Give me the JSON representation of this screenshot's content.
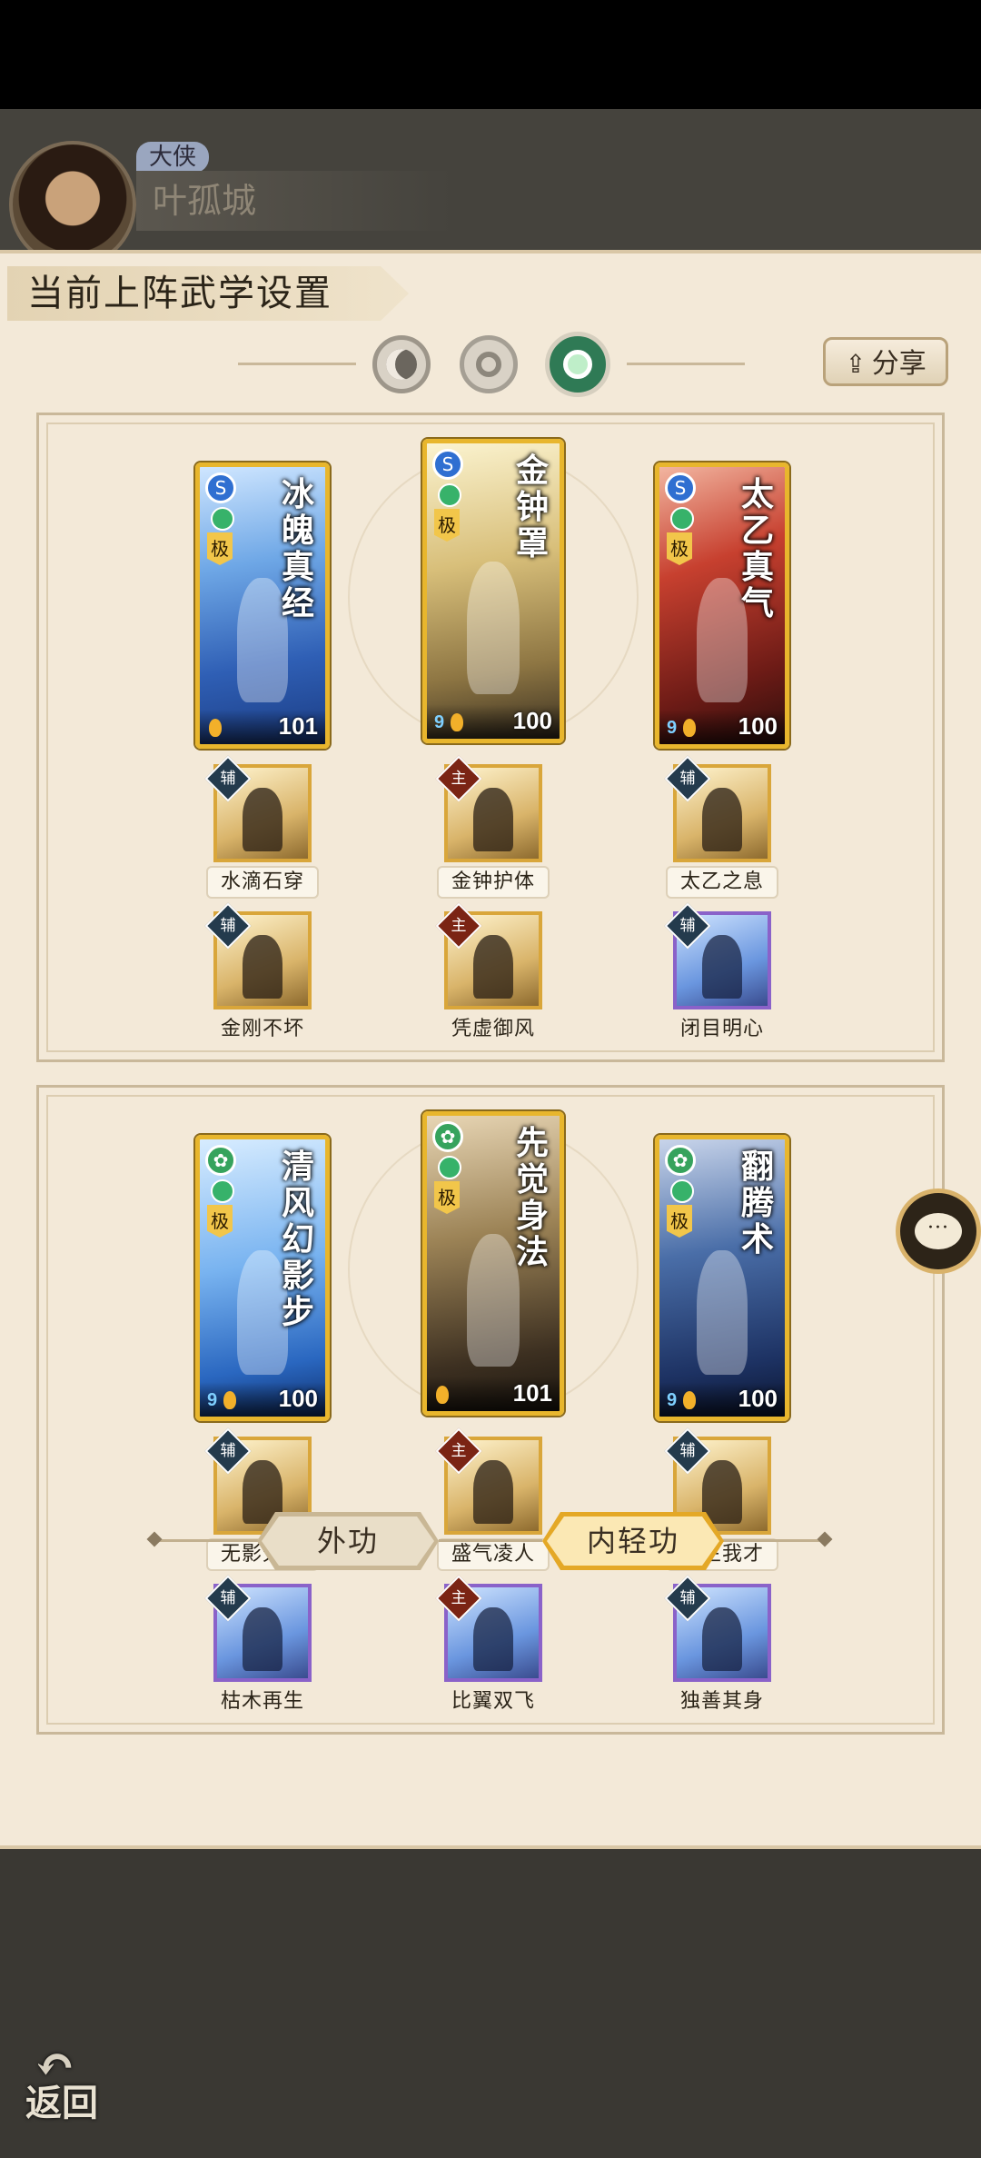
{
  "player": {
    "rank": "大侠",
    "name": "叶孤城"
  },
  "panel": {
    "title": "当前上阵武学设置",
    "share_label": "分享"
  },
  "modes": [
    "moon-icon",
    "sun-icon",
    "leaf-icon"
  ],
  "section1": {
    "cards": [
      {
        "title": "冰魄真经",
        "type": "S",
        "grade": "极",
        "level": "101",
        "star": ""
      },
      {
        "title": "金钟罩",
        "type": "S",
        "grade": "极",
        "level": "100",
        "star": "9"
      },
      {
        "title": "太乙真气",
        "type": "S",
        "grade": "极",
        "level": "100",
        "star": "9"
      }
    ],
    "skills_row1": [
      {
        "tag": "辅",
        "label": "水滴石穿"
      },
      {
        "tag": "主",
        "label": "金钟护体"
      },
      {
        "tag": "辅",
        "label": "太乙之息"
      }
    ],
    "skills_row2": [
      {
        "tag": "辅",
        "label": "金刚不坏"
      },
      {
        "tag": "主",
        "label": "凭虚御风"
      },
      {
        "tag": "辅",
        "label": "闭目明心"
      }
    ]
  },
  "section2": {
    "cards": [
      {
        "title": "清风幻影步",
        "type": "✿",
        "grade": "极",
        "level": "100",
        "star": "9"
      },
      {
        "title": "先觉身法",
        "type": "✿",
        "grade": "极",
        "level": "101",
        "star": ""
      },
      {
        "title": "翻腾术",
        "type": "✿",
        "grade": "极",
        "level": "100",
        "star": "9"
      }
    ],
    "skills_row1": [
      {
        "tag": "辅",
        "label": "无影无形"
      },
      {
        "tag": "主",
        "label": "盛气凌人"
      },
      {
        "tag": "辅",
        "label": "天生我才"
      }
    ],
    "skills_row2": [
      {
        "tag": "辅",
        "label": "枯木再生"
      },
      {
        "tag": "主",
        "label": "比翼双飞"
      },
      {
        "tag": "辅",
        "label": "独善其身"
      }
    ]
  },
  "tabs": {
    "outer": "外功",
    "inner": "内轻功",
    "active": "内轻功"
  },
  "back_label": "返回"
}
